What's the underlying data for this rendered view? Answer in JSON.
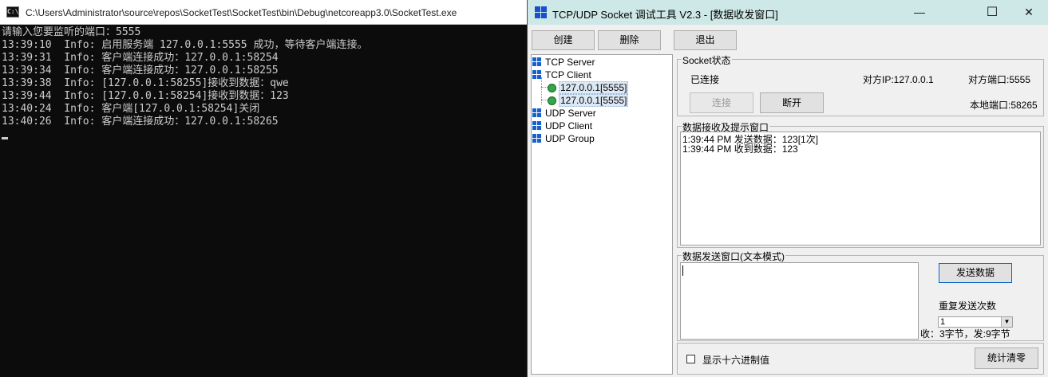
{
  "console": {
    "title": "C:\\Users\\Administrator\\source\\repos\\SocketTest\\SocketTest\\bin\\Debug\\netcoreapp3.0\\SocketTest.exe",
    "icon": "console-icon",
    "lines": [
      "请输入您要监听的端口：5555",
      "13:39:10  Info: 启用服务端 127.0.0.1:5555 成功，等待客户端连接。",
      "13:39:31  Info: 客户端连接成功：127.0.0.1:58254",
      "13:39:34  Info: 客户端连接成功：127.0.0.1:58255",
      "13:39:38  Info: [127.0.0.1:58255]接收到数据：qwe",
      "13:39:44  Info: [127.0.0.1:58254]接收到数据：123",
      "13:40:24  Info: 客户端[127.0.0.1:58254]关闭",
      "13:40:26  Info: 客户端连接成功：127.0.0.1:58265"
    ]
  },
  "tool": {
    "title": "TCP/UDP Socket 调试工具 V2.3 - [数据收发窗口]",
    "window_controls": {
      "minimize": "—",
      "maximize": "☐",
      "close": "✕"
    },
    "toolbar": {
      "create": "创建",
      "delete": "删除",
      "exit": "退出"
    },
    "tree": {
      "tcp_server": "TCP Server",
      "tcp_client": "TCP Client",
      "clients": [
        "127.0.0.1[5555]",
        "127.0.0.1[5555]"
      ],
      "udp_server": "UDP Server",
      "udp_client": "UDP Client",
      "udp_group": "UDP Group"
    },
    "socket_status": {
      "title": "Socket状态",
      "state": "已连接",
      "remote_ip": "对方IP:127.0.0.1",
      "remote_port": "对方端口:5555",
      "local_port": "本地端口:58265",
      "connect": "连接",
      "disconnect": "断开"
    },
    "receive": {
      "title": "数据接收及提示窗口",
      "lines": [
        "1:39:44 PM 发送数据：123[1次]",
        "1:39:44 PM 收到数据：123"
      ]
    },
    "send": {
      "title": "数据发送窗口(文本模式)",
      "send_button": "发送数据",
      "repeat_label": "重复发送次数",
      "repeat_value": "1",
      "stats": "收：3字节，发:9字节"
    },
    "bottom": {
      "hex_checkbox": "显示十六进制值",
      "clear_stats": "统计清零"
    },
    "colors": {
      "accent": "#1560d0",
      "title_bg": "#cde8e6",
      "console_bg": "#0c0c0c"
    }
  }
}
